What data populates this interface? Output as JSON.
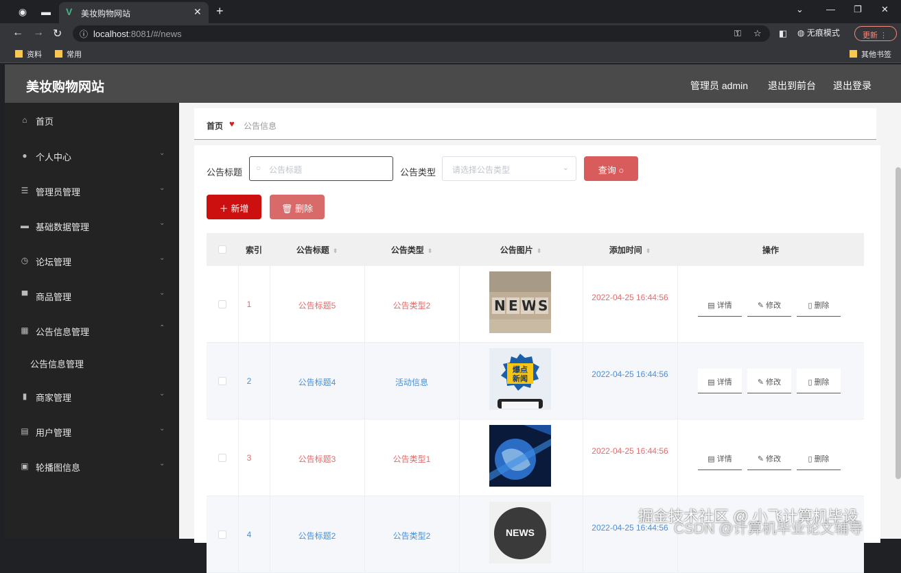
{
  "browser": {
    "tab_title": "美妆购物网站",
    "url_host": "localhost",
    "url_rest": ":8081/#/news",
    "incognito_label": "无痕模式",
    "update_label": "更新",
    "bookmarks": [
      "资料",
      "常用"
    ],
    "other_bookmarks": "其他书签"
  },
  "header": {
    "brand": "美妆购物网站",
    "admin_label": "管理员 admin",
    "to_front": "退出到前台",
    "logout": "退出登录"
  },
  "sidebar": {
    "items": [
      {
        "label": "首页",
        "icon": "home-icon"
      },
      {
        "label": "个人中心",
        "icon": "user-icon"
      },
      {
        "label": "管理员管理",
        "icon": "sliders-icon"
      },
      {
        "label": "基础数据管理",
        "icon": "monitor-icon"
      },
      {
        "label": "论坛管理",
        "icon": "clock-icon"
      },
      {
        "label": "商品管理",
        "icon": "box-icon"
      },
      {
        "label": "公告信息管理",
        "icon": "grid-icon"
      },
      {
        "label": "商家管理",
        "icon": "bar-chart-icon"
      },
      {
        "label": "用户管理",
        "icon": "doc-icon"
      },
      {
        "label": "轮播图信息",
        "icon": "clipboard-icon"
      }
    ],
    "sub_item": "公告信息管理"
  },
  "breadcrumb": {
    "home": "首页",
    "current": "公告信息"
  },
  "search": {
    "title_label": "公告标题",
    "title_placeholder": "公告标题",
    "type_label": "公告类型",
    "type_placeholder": "请选择公告类型",
    "query_button": "查询"
  },
  "actions": {
    "add": "新增",
    "delete": "删除"
  },
  "table": {
    "headers": [
      "索引",
      "公告标题",
      "公告类型",
      "公告图片",
      "添加时间",
      "操作"
    ],
    "op_labels": {
      "detail": "详情",
      "edit": "修改",
      "delete": "删除"
    },
    "rows": [
      {
        "index": "1",
        "title": "公告标题5",
        "type": "公告类型2",
        "time": "2022-04-25 16:44:56",
        "image": "news-letters",
        "color": "red"
      },
      {
        "index": "2",
        "title": "公告标题4",
        "type": "活动信息",
        "time": "2022-04-25 16:44:56",
        "image": "breaking-news-phone",
        "color": "blue"
      },
      {
        "index": "3",
        "title": "公告标题3",
        "type": "公告类型1",
        "time": "2022-04-25 16:44:56",
        "image": "globe-news",
        "color": "red"
      },
      {
        "index": "4",
        "title": "公告标题2",
        "type": "公告类型2",
        "time": "2022-04-25 16:44:56",
        "image": "news-circle",
        "color": "blue"
      }
    ]
  },
  "watermark": {
    "line1": "掘金技术社区 @ 小飞计算机毕设",
    "line2": "CSDN @计算机毕业论文辅导"
  }
}
